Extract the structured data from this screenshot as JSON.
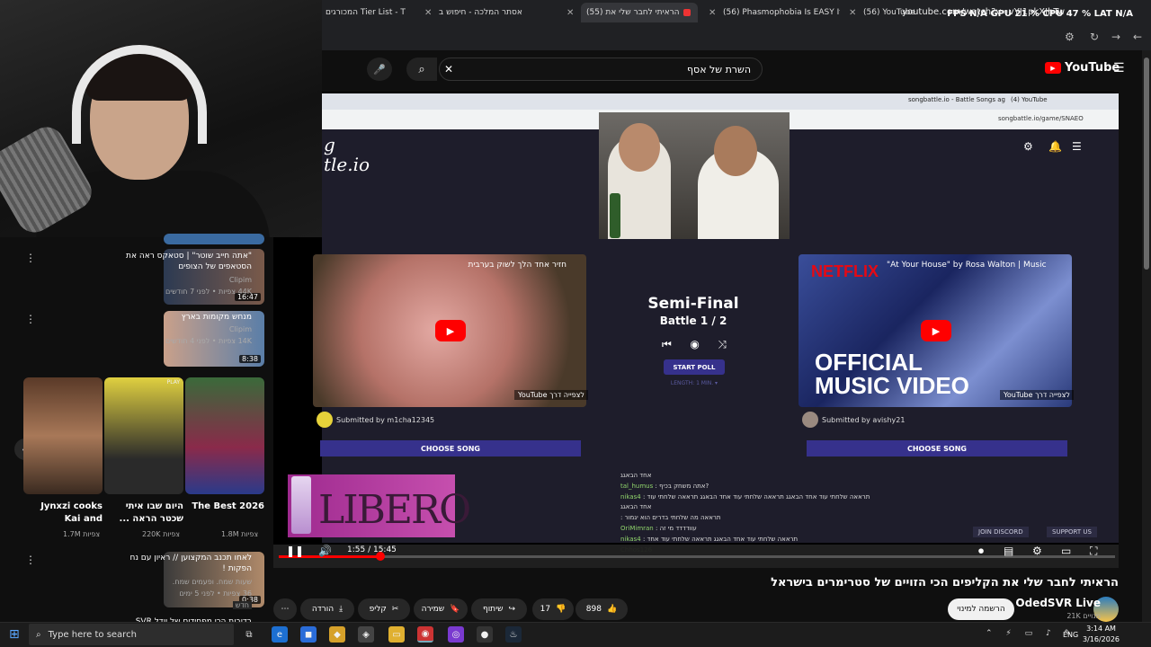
{
  "browser": {
    "tabs": [
      {
        "label": "המכורגים Tier List - T",
        "active": false
      },
      {
        "label": "Google ב- - חיפוש ב",
        "active": false
      },
      {
        "label": "אסתר המלכה - חיפוש ב",
        "active": false
      },
      {
        "label": "(55) הראיתי לחבר שלי את",
        "active": true
      },
      {
        "label": "(56) Phasmophobia Is EASY If Y",
        "active": false
      },
      {
        "label": "(56) YouTube",
        "active": false
      }
    ],
    "url": "youtube.com/watch?v=vYJ1pkXJhTw",
    "perf_overlay": "FPS N/A   GPU 21 %   CPU 47 %   LAT N/A"
  },
  "youtube": {
    "search_value": "השרת של אסף",
    "logo_text": "YouTube",
    "video_title": "הראיתי לחבר שלי את הקליפים הכי הזויים של סטרימרים בישראל",
    "channel_name": "OdedSVR Live",
    "channel_subs": "21K מנויים",
    "subscribe_label": "הרשמה למינוי",
    "likes": "898",
    "dislikes": "17",
    "share_label": "שיתוף",
    "save_label": "שמירה",
    "clip_label": "קליפ",
    "download_label": "הורדה",
    "time_display": "1:55 / 15:45",
    "progress_fraction": 0.122
  },
  "sidebar": {
    "videos": [
      {
        "title": "\"אתה חייב שוטר\" | סטאקס ראה את הסטאפים של הצופים",
        "channel": "Clipim",
        "meta": "44K צפיות • לפני 7 חודשים",
        "duration": "16:47"
      },
      {
        "title": "מנחש מקומות בארץ",
        "channel": "Clipim",
        "meta": "14K צפיות • לפני 4 חודשים",
        "duration": "8:38"
      },
      {
        "title": "לאחו תכנב המקצוען // ראיון עם נח הפקות !",
        "channel": "שעות שמח. ופעמים שמח.",
        "meta": "36 צפיות • לפני 5 ימים",
        "duration": "0:38",
        "badge": "חדש"
      },
      {
        "title": "בדיבות הכי מפחידים של יודל SVR",
        "channel": "",
        "meta": "",
        "duration": ""
      }
    ],
    "shorts": [
      {
        "title": "Jynxzi cooks Kai and",
        "views": "1.7M צפיות"
      },
      {
        "title": "היום שבו איתי שכטר הראה ...",
        "views": "220K צפיות"
      },
      {
        "title": "The Best 2026",
        "views": "1.8M צפיות"
      }
    ],
    "shorts_tag": "PLAY"
  },
  "stream": {
    "inner_tabs": [
      "songbattle.io - Battle Songs ag",
      "(4) YouTube"
    ],
    "inner_url": "songbattle.io/game/SNAEO",
    "site_logo": "g\ntle.io",
    "round": "Semi-Final",
    "battle": "Battle 1 / 2",
    "start_poll": "START POLL",
    "length_label": "LENGTH: 1 MIN. ▾",
    "left_video_title": "חזיר אחד הלך לשוק בערבית",
    "left_submitted": "Submitted by m1cha12345",
    "right_video_title": "\"At Your House\" by Rosa Walton | Music Video",
    "right_submitted": "Submitted by avishy21",
    "choose_song": "CHOOSE SONG",
    "netflix": "NETFLIX",
    "official": "OFFICIAL\nMUSIC VIDEO",
    "yt_watermark": "YouTube לצפייה דרך",
    "join_discord": "JOIN DISCORD",
    "support_us": "SUPPORT US",
    "ad_brand": "LIBERO",
    "chat": [
      {
        "user": "",
        "text": "אחד הבאגג",
        "color": "plain"
      },
      {
        "user": "tal_humus",
        "text": ": אתה משחק בכיף?",
        "color": "u"
      },
      {
        "user": "nikas4",
        "text": ": תראאה שלחתי עוד אחד הבאגג תראאה שלחתי עוד אחד הבאגג תראאה שלחתי עוד",
        "color": "plain"
      },
      {
        "user": "",
        "text": "אחד הבאגג",
        "color": "plain"
      },
      {
        "user": "",
        "text": ": תראאה מה שלחתי בדרים הוא יגמור",
        "color": "r"
      },
      {
        "user": "OriMimran",
        "text": ": עוודדדד מי זה",
        "color": "u"
      },
      {
        "user": "nikas4",
        "text": ": תראאה שלחתי עוד אחד הבאגג תראאה שלחתי עוד אחד",
        "color": "plain"
      },
      {
        "user": "Chhos126",
        "text": "",
        "color": "u"
      }
    ]
  },
  "taskbar": {
    "search_placeholder": "Type here to search",
    "lang": "ENG",
    "time": "3:14 AM",
    "date": "3/16/2026"
  },
  "colors": {
    "accent": "#ff0000",
    "battle_purple": "#36318c",
    "page_bg": "#0f0f0f"
  }
}
